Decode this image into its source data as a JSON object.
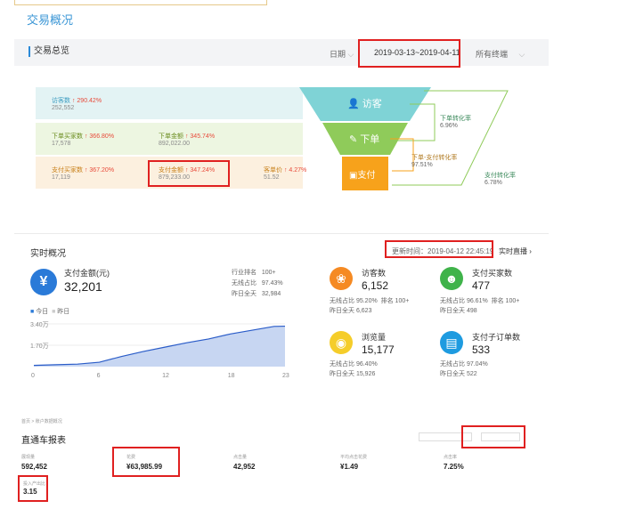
{
  "page_title": "交易概况",
  "summary": {
    "title": "交易总览",
    "date_label": "日期",
    "date_range": "2019-03-13~2019-04-11",
    "terminal_label": "所有终端"
  },
  "funnel": {
    "visitors": {
      "label": "访客数",
      "change": "290.42%",
      "value": "252,552"
    },
    "order_buyers": {
      "label": "下单买家数",
      "change": "366.80%",
      "value": "17,578"
    },
    "order_amount": {
      "label": "下单金额",
      "change": "345.74%",
      "value": "892,022.00"
    },
    "pay_buyers": {
      "label": "支付买家数",
      "change": "367.20%",
      "value": "17,119"
    },
    "pay_amount": {
      "label": "支付金额",
      "change": "347.24%",
      "value": "879,233.00"
    },
    "unit_price": {
      "label": "客单价",
      "change": "4.27%",
      "value": "51.52"
    },
    "stage_visitor": "访客",
    "stage_order": "下单",
    "stage_pay": "支付",
    "conv_order": {
      "label": "下单转化率",
      "value": "6.96%"
    },
    "conv_order_pay": {
      "label": "下单-支付转化率",
      "value": "97.51%"
    },
    "conv_pay": {
      "label": "支付转化率",
      "value": "6.78%"
    }
  },
  "realtime": {
    "title": "实时概况",
    "update_time": "更新时间：2019-04-12 22:45:19",
    "live_link": "实时直播 ›",
    "pay_amount": {
      "label": "支付金额(元)",
      "value": "32,201",
      "rank_label": "行业排名",
      "rank_value": "100+",
      "wireless_label": "无线占比",
      "wireless_value": "97.43%",
      "yesterday_label": "昨日全天",
      "yesterday_value": "32,984"
    },
    "legend_today": "今日",
    "legend_yesterday": "昨日",
    "y_ticks": [
      "3.40万",
      "1.70万"
    ],
    "x_ticks": [
      "0",
      "6",
      "12",
      "18",
      "23"
    ],
    "visitors": {
      "label": "访客数",
      "value": "6,152",
      "l1": "无线占比",
      "v1": "95.20%",
      "rank": "排名",
      "rank_v": "100+",
      "l2": "昨日全天",
      "v2": "6,623"
    },
    "buyers": {
      "label": "支付买家数",
      "value": "477",
      "l1": "无线占比",
      "v1": "96.61%",
      "rank": "排名",
      "rank_v": "100+",
      "l2": "昨日全天",
      "v2": "498"
    },
    "pageviews": {
      "label": "浏览量",
      "value": "15,177",
      "l1": "无线占比",
      "v1": "96.40%",
      "l2": "昨日全天",
      "v2": "15,926"
    },
    "suborders": {
      "label": "支付子订单数",
      "value": "533",
      "l1": "无线占比",
      "v1": "97.04%",
      "l2": "昨日全天",
      "v2": "522"
    }
  },
  "chart_data": {
    "type": "area",
    "x": [
      0,
      2,
      4,
      6,
      8,
      10,
      12,
      14,
      16,
      18,
      20,
      22,
      23
    ],
    "series": [
      {
        "name": "今日",
        "values": [
          0.1,
          0.15,
          0.2,
          0.35,
          0.8,
          1.2,
          1.55,
          1.9,
          2.2,
          2.6,
          2.9,
          3.2,
          3.22
        ]
      }
    ],
    "ylim": [
      0,
      3.4
    ],
    "yticks": [
      "3.40万",
      "1.70万"
    ]
  },
  "bottom": {
    "breadcrumb": "首页 > 账户数据概况",
    "title": "直通车报表",
    "spend_label": "展现量",
    "spend_value": "592,452",
    "cost_label": "花费",
    "cost_value": "¥63,985.99",
    "clicks_label": "点击量",
    "clicks_value": "42,952",
    "cpc_label": "平均点击花费",
    "cpc_value": "¥1.49",
    "ctr_label": "点击率",
    "ctr_value": "7.25%",
    "roi_label": "投入产出比",
    "roi_value": "3.15"
  },
  "colors": {
    "accent": "#3c97d6",
    "funnel_visitor": "#7fd3d6",
    "funnel_order": "#8fcb5a",
    "funnel_pay": "#f7a21b",
    "highlight": "#e02020"
  }
}
